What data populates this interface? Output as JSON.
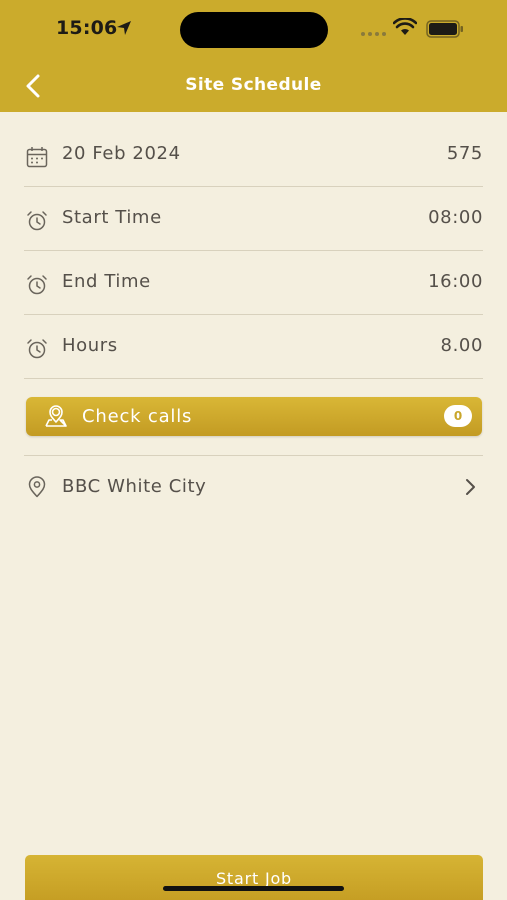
{
  "status_bar": {
    "time": "15:06"
  },
  "nav": {
    "title": "Site Schedule"
  },
  "details": [
    {
      "icon": "calendar-icon",
      "label": "20 Feb 2024",
      "value": "575"
    },
    {
      "icon": "alarm-clock-icon",
      "label": "Start Time",
      "value": "08:00"
    },
    {
      "icon": "alarm-clock-icon",
      "label": "End Time",
      "value": "16:00"
    },
    {
      "icon": "alarm-clock-icon",
      "label": "Hours",
      "value": "8.00"
    }
  ],
  "check_calls": {
    "icon": "map-pin-person-icon",
    "label": "Check calls",
    "count": "0"
  },
  "site": {
    "icon": "location-pin-icon",
    "label": "BBC White City"
  },
  "start_job": {
    "label": "Start Job"
  },
  "colors": {
    "accent": "#cbab2c",
    "background": "#f4efdf",
    "text": "#55504a"
  }
}
